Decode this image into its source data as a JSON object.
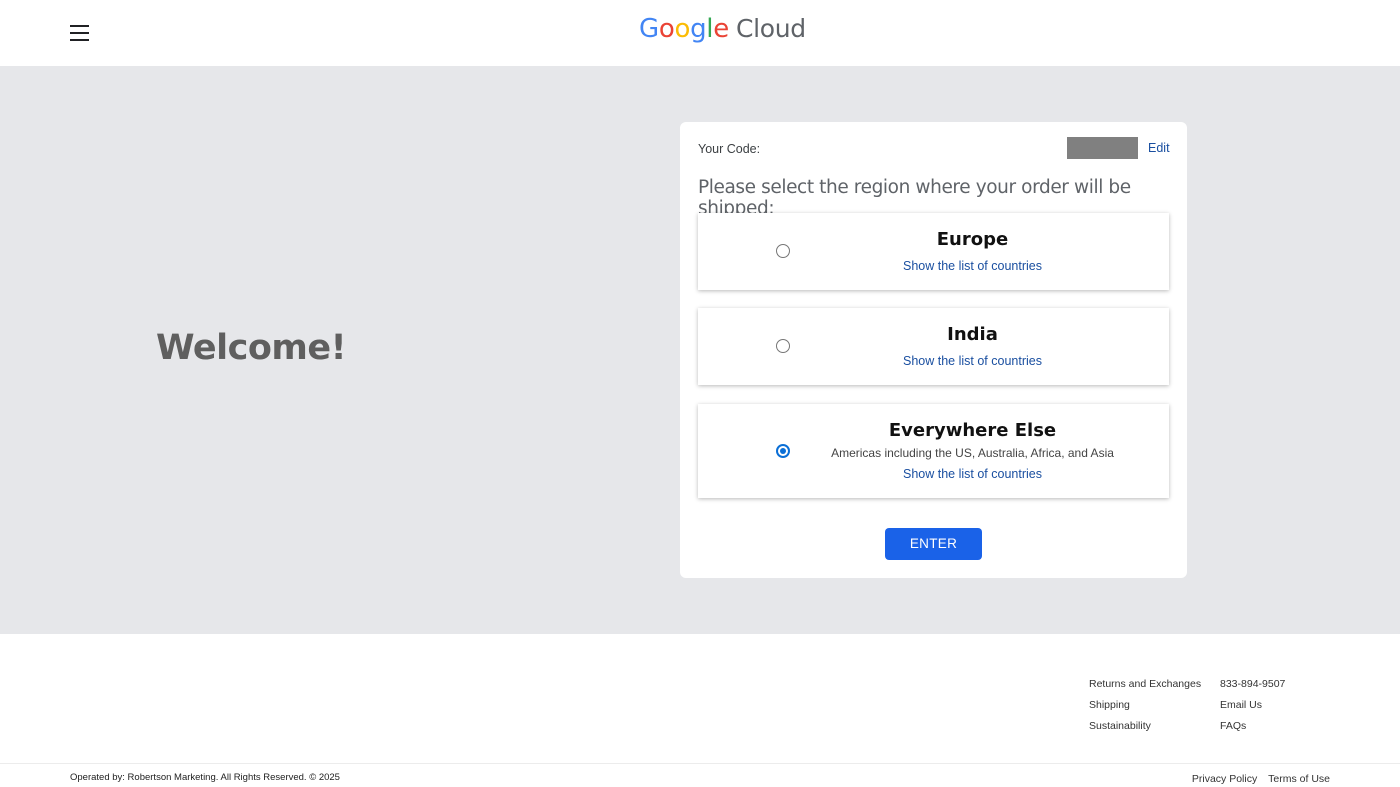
{
  "header": {
    "menu_icon": "hamburger-menu-icon",
    "logo": {
      "google_letters": [
        {
          "char": "G",
          "color": "#4285F4"
        },
        {
          "char": "o",
          "color": "#EA4335"
        },
        {
          "char": "o",
          "color": "#FBBC05"
        },
        {
          "char": "g",
          "color": "#4285F4"
        },
        {
          "char": "l",
          "color": "#34A853"
        },
        {
          "char": "e",
          "color": "#EA4335"
        }
      ],
      "cloud_text": "Cloud"
    }
  },
  "main": {
    "welcome": "Welcome!",
    "code_label": "Your Code:",
    "edit_label": "Edit",
    "prompt": "Please select the region where your order will be shipped:",
    "options": [
      {
        "title": "Europe",
        "subtitle": "",
        "link": "Show the list of countries",
        "selected": false
      },
      {
        "title": "India",
        "subtitle": "",
        "link": "Show the list of countries",
        "selected": false
      },
      {
        "title": "Everywhere Else",
        "subtitle": "Americas including the US, Australia, Africa, and Asia",
        "link": "Show the list of countries",
        "selected": true
      }
    ],
    "enter_label": "ENTER"
  },
  "footer": {
    "col1": [
      "Returns and Exchanges",
      "Shipping",
      "Sustainability"
    ],
    "col2": [
      "833-894-9507",
      "Email Us",
      "FAQs"
    ],
    "copyright": "Operated by: Robertson Marketing. All Rights Reserved. © 2025",
    "privacy": "Privacy Policy",
    "terms": "Terms of Use"
  },
  "colors": {
    "accent": "#1a62e8",
    "link": "#1a4fa0",
    "background_band": "#e6e7ea",
    "radio_selected": "#0b6fd6"
  }
}
